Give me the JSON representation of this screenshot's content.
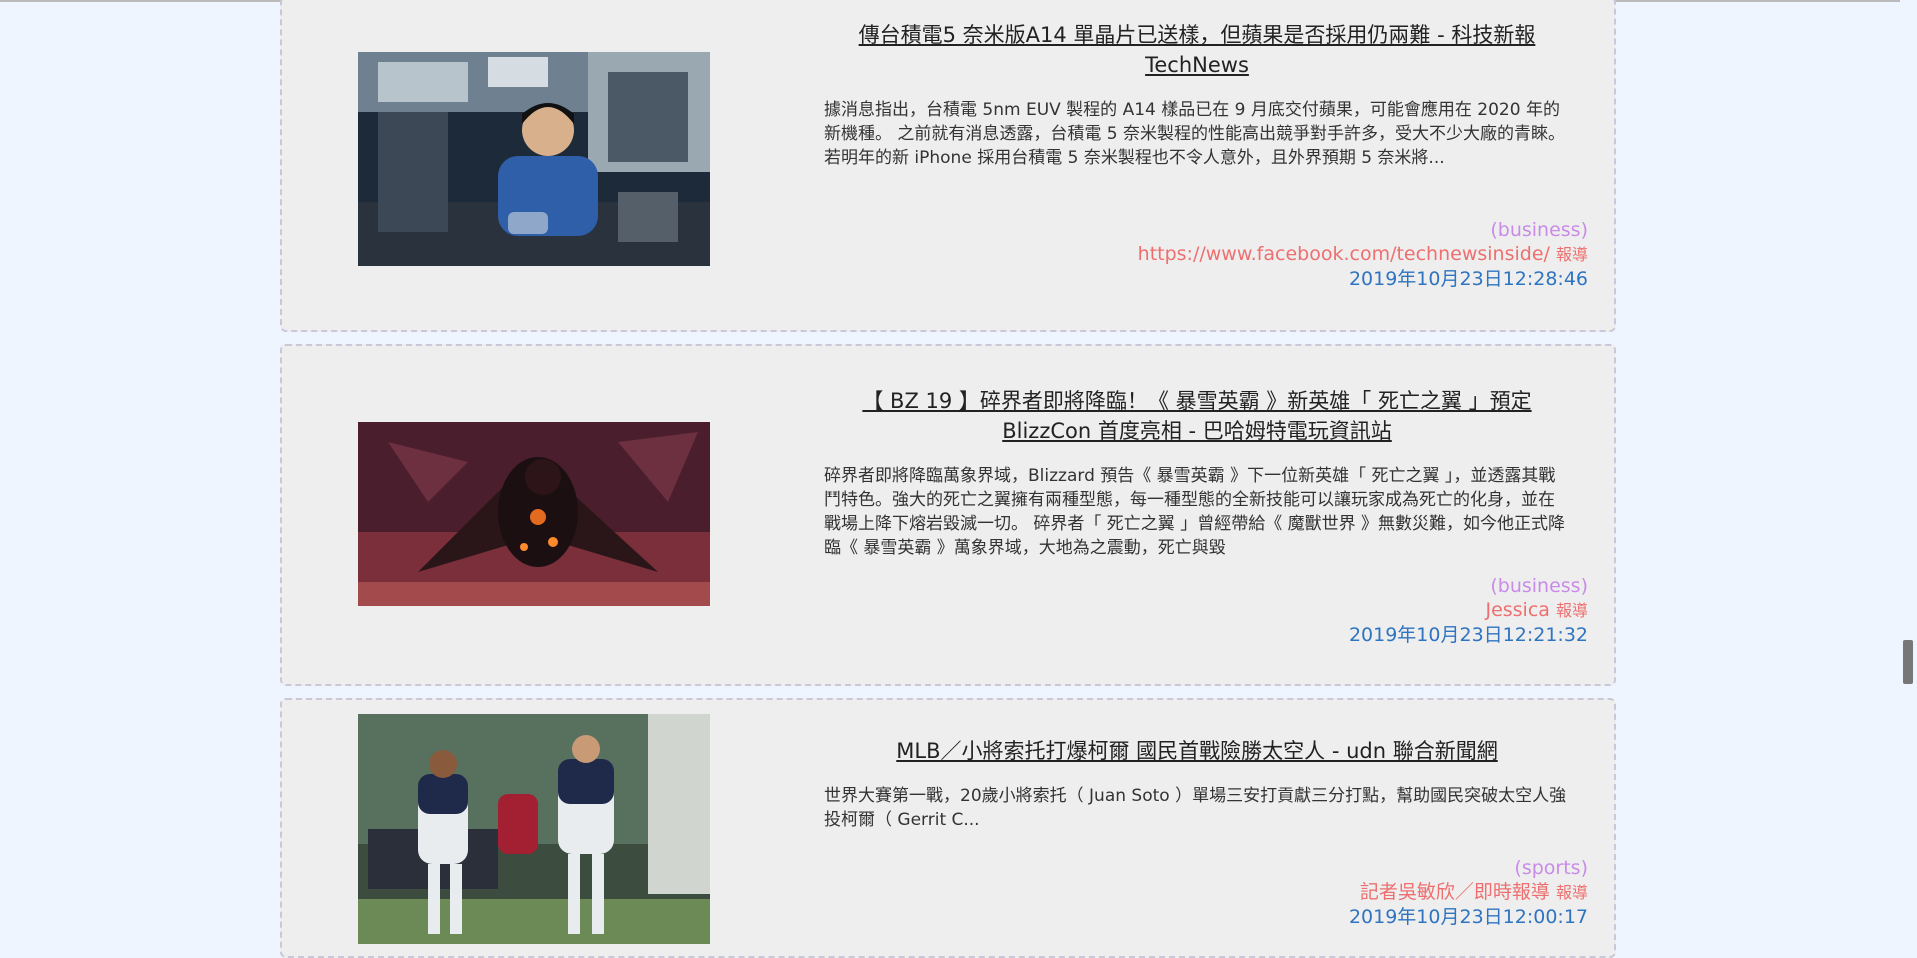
{
  "articles": [
    {
      "title": "傳台積電5 奈米版A14 單晶片已送樣，但蘋果是否採用仍兩難 - 科技新報 TechNews",
      "description": "據消息指出，台積電 5nm EUV 製程的 A14 樣品已在 9 月底交付蘋果，可能會應用在 2020 年的新機種。 之前就有消息透露，台積電 5 奈米製程的性能高出競爭對手許多，受大不少大廠的青睞。若明年的新 iPhone 採用台積電 5 奈米製程也不令人意外，且外界預期 5 奈米將...",
      "category": "(business)",
      "reporter": "https://www.facebook.com/technewsinside/",
      "reporter_suffix": "報導",
      "date": "2019年10月23日12:28:46",
      "image_icon": "engineer-photo"
    },
    {
      "title": "【 BZ 19 】碎界者即將降臨！《 暴雪英霸 》新英雄「 死亡之翼 」預定 BlizzCon 首度亮相 - 巴哈姆特電玩資訊站",
      "description": "碎界者即將降臨萬象界域，Blizzard 預告《 暴雪英霸 》下一位新英雄「 死亡之翼 」，並透露其戰鬥特色。強大的死亡之翼擁有兩種型態，每一種型態的全新技能可以讓玩家成為死亡的化身，並在戰場上降下熔岩毀滅一切。 碎界者「 死亡之翼 」曾經帶給《 魔獸世界 》無數災難，如今他正式降臨《 暴雪英霸 》萬象界域，大地為之震動，死亡與毀",
      "category": "(business)",
      "reporter": "Jessica",
      "reporter_suffix": "報導",
      "date": "2019年10月23日12:21:32",
      "image_icon": "dragon-artwork"
    },
    {
      "title": "MLB／小將索托打爆柯爾 國民首戰險勝太空人 - udn 聯合新聞網",
      "description": "世界大賽第一戰，20歲小將索托（ Juan Soto ）單場三安打貢獻三分打點，幫助國民突破太空人強投柯爾（ Gerrit C...",
      "category": "(sports)",
      "reporter": "記者吳敏欣／即時報導",
      "reporter_suffix": "報導",
      "date": "2019年10月23日12:00:17",
      "image_icon": "baseball-players-photo"
    }
  ],
  "colors": {
    "category": "#c98be8",
    "reporter": "#ee6f6f",
    "date": "#2f74c0",
    "card_bg": "#eeeeee",
    "page_bg": "#eef5ff"
  }
}
